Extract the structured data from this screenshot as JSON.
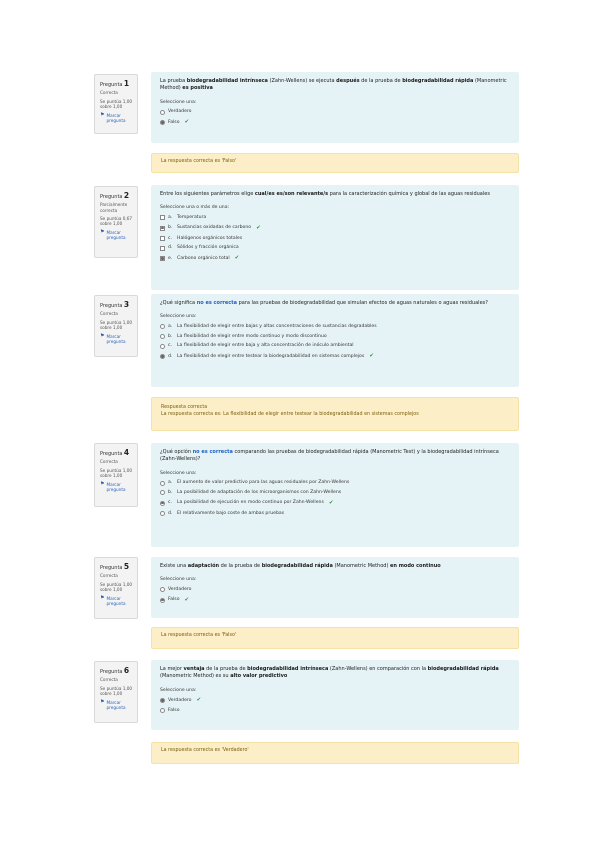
{
  "common": {
    "question_label": "Pregunta",
    "select_one": "Seleccione una:",
    "select_one_or_more": "Seleccione una o más de una:",
    "flag_label": "Marcar pregunta"
  },
  "questions": [
    {
      "number": "1",
      "state": "Correcta",
      "grade": "Se puntúa 1,00 sobre 1,00",
      "text_parts": [
        {
          "t": "La prueba "
        },
        {
          "t": "biodegradabilidad intrínseca",
          "b": true
        },
        {
          "t": " (Zahn-Wellens) se ejecuta "
        },
        {
          "t": "después",
          "b": true
        },
        {
          "t": " de la prueba de "
        },
        {
          "t": "biodegradabilidad rápida",
          "b": true
        },
        {
          "t": " (Manometric Method) "
        },
        {
          "t": "es positiva",
          "b": true
        }
      ],
      "prompt_key": "select_one",
      "kind": "radio",
      "options": [
        {
          "letter": "",
          "label": "Verdadero",
          "checked": false,
          "correct": false
        },
        {
          "letter": "",
          "label": "Falso",
          "checked": true,
          "correct": true
        }
      ],
      "feedback": [
        "La respuesta correcta es 'Falso'"
      ]
    },
    {
      "number": "2",
      "state": "Parcialmente correcta",
      "grade": "Se puntúa 0,67 sobre 1,00",
      "text_parts": [
        {
          "t": "Entre los siguientes parámetros elige "
        },
        {
          "t": "cual/es es/son relevante/s",
          "b": true
        },
        {
          "t": " para la caracterización química y global de las aguas residuales"
        }
      ],
      "prompt_key": "select_one_or_more",
      "kind": "checkbox",
      "options": [
        {
          "letter": "a.",
          "label": "Temperatura",
          "checked": false,
          "correct": false
        },
        {
          "letter": "b.",
          "label": "Sustancias oxidadas de carbono",
          "checked": true,
          "correct": true
        },
        {
          "letter": "c.",
          "label": "Halógenos orgánicos totales",
          "checked": false,
          "correct": false
        },
        {
          "letter": "d.",
          "label": "Sólidos y fracción orgánica",
          "checked": false,
          "correct": false
        },
        {
          "letter": "e.",
          "label": "Carbono orgánico total",
          "checked": true,
          "correct": true
        }
      ],
      "feedback": []
    },
    {
      "number": "3",
      "state": "Correcta",
      "grade": "Se puntúa 1,00 sobre 1,00",
      "text_parts": [
        {
          "t": "¿Qué significa "
        },
        {
          "t": "no es correcta",
          "link": true
        },
        {
          "t": " para las pruebas de biodegradabilidad que simulan efectos de aguas naturales o aguas residuales?"
        }
      ],
      "prompt_key": "select_one",
      "kind": "radio",
      "options": [
        {
          "letter": "a.",
          "label": "La flexibilidad de elegir entre bajas y altas concentraciones de sustancias degradables",
          "checked": false,
          "correct": false
        },
        {
          "letter": "b.",
          "label": "La flexibilidad de elegir entre modo continuo y modo discontinuo",
          "checked": false,
          "correct": false
        },
        {
          "letter": "c.",
          "label": "La flexibilidad de elegir entre baja y alta concentración de inóculo ambiental",
          "checked": false,
          "correct": false
        },
        {
          "letter": "d.",
          "label": "La flexibilidad de elegir entre testear la biodegradabilidad en sistemas complejos",
          "checked": true,
          "correct": true
        }
      ],
      "feedback": [
        "Respuesta correcta",
        "La respuesta correcta es: La flexibilidad de elegir entre testear la biodegradabilidad en sistemas complejos"
      ]
    },
    {
      "number": "4",
      "state": "Correcta",
      "grade": "Se puntúa 1,00 sobre 1,00",
      "text_parts": [
        {
          "t": "¿Qué opción "
        },
        {
          "t": "no es correcta",
          "link": true
        },
        {
          "t": " comparando las pruebas de biodegradabilidad rápida (Manometric Test) y la biodegradabilidad intrínseca (Zahn-Wellens)?"
        }
      ],
      "prompt_key": "select_one",
      "kind": "radio",
      "options": [
        {
          "letter": "a.",
          "label": "El aumento de valor predictivo para las aguas residuales por Zahn-Wellens",
          "checked": false,
          "correct": false
        },
        {
          "letter": "b.",
          "label": "La posibilidad de adaptación de los microorganismos con Zahn-Wellens",
          "checked": false,
          "correct": false
        },
        {
          "letter": "c.",
          "label": "La posibilidad de ejecución en modo continuo por Zahn-Wellens",
          "checked": true,
          "correct": true
        },
        {
          "letter": "d.",
          "label": "El relativamente bajo coste de ambas pruebas",
          "checked": false,
          "correct": false
        }
      ],
      "feedback": []
    },
    {
      "number": "5",
      "state": "Correcta",
      "grade": "Se puntúa 1,00 sobre 1,00",
      "text_parts": [
        {
          "t": "Existe una "
        },
        {
          "t": "adaptación",
          "b": true
        },
        {
          "t": " de la prueba de "
        },
        {
          "t": "biodegradabilidad rápida",
          "b": true
        },
        {
          "t": " (Manometric Method) "
        },
        {
          "t": "en modo continuo",
          "b": true
        }
      ],
      "prompt_key": "select_one",
      "kind": "radio",
      "options": [
        {
          "letter": "",
          "label": "Verdadero",
          "checked": false,
          "correct": false
        },
        {
          "letter": "",
          "label": "Falso",
          "checked": true,
          "correct": true
        }
      ],
      "feedback": [
        "La respuesta correcta es 'Falso'"
      ]
    },
    {
      "number": "6",
      "state": "Correcta",
      "grade": "Se puntúa 1,00 sobre 1,00",
      "text_parts": [
        {
          "t": "La mejor "
        },
        {
          "t": "ventaja",
          "b": true
        },
        {
          "t": " de la prueba de "
        },
        {
          "t": "biodegradabilidad intrínseca",
          "b": true
        },
        {
          "t": " (Zahn-Wellens) en comparación con la "
        },
        {
          "t": "biodegradabilidad rápida",
          "b": true
        },
        {
          "t": " (Manometric Method) es su "
        },
        {
          "t": "alto valor predictivo",
          "b": true
        }
      ],
      "prompt_key": "select_one",
      "kind": "radio",
      "options": [
        {
          "letter": "",
          "label": "Verdadero",
          "checked": true,
          "correct": true
        },
        {
          "letter": "",
          "label": "Falso",
          "checked": false,
          "correct": false
        }
      ],
      "feedback": [
        "La respuesta correcta es 'Verdadero'"
      ]
    }
  ]
}
